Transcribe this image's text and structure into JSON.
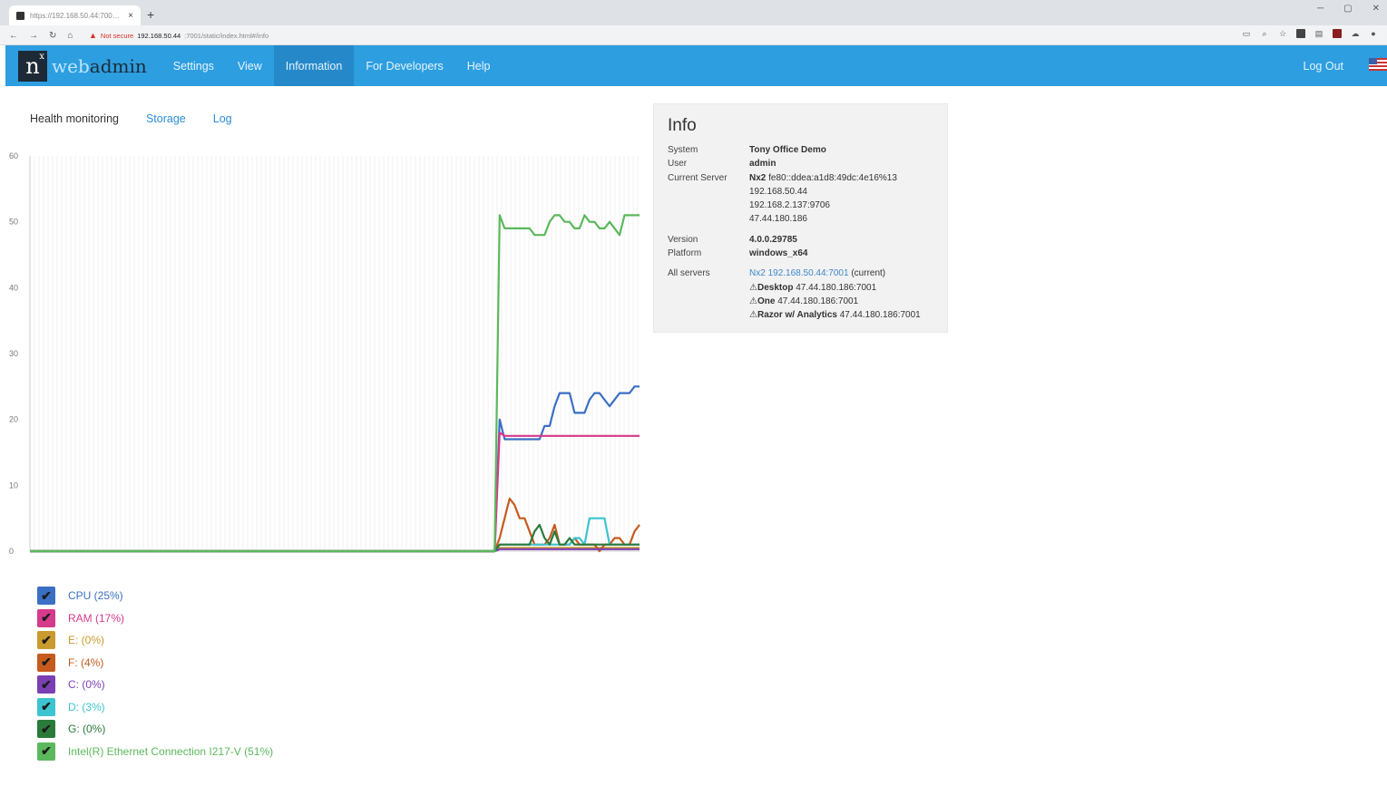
{
  "browser": {
    "tab_title": "https://192.168.50.44:7001/static/index.html#/serv",
    "tab_close": "×",
    "new_tab": "+",
    "not_secure": "Not secure",
    "url_host": "192.168.50.44",
    "url_path": ":7001/static/index.html#/info"
  },
  "app": {
    "logo_mark": "n",
    "logo_sup": "x",
    "logo_web": "web",
    "logo_admin": "admin",
    "menu": [
      "Settings",
      "View",
      "Information",
      "For Developers",
      "Help"
    ],
    "active_menu": "Information",
    "logout": "Log Out"
  },
  "subnav": {
    "health": "Health monitoring",
    "storage": "Storage",
    "log": "Log"
  },
  "chart_data": {
    "type": "line",
    "ylim": [
      0,
      60
    ],
    "y_ticks": [
      "60",
      "50",
      "40",
      "30",
      "20",
      "10",
      "0"
    ],
    "grid": true,
    "series": [
      {
        "name": "CPU (25%)",
        "color": "#3a6fc4",
        "values": [
          0,
          0,
          0,
          0,
          0,
          0,
          0,
          0,
          0,
          0,
          0,
          0,
          0,
          0,
          0,
          0,
          0,
          0,
          0,
          0,
          0,
          0,
          0,
          0,
          0,
          0,
          0,
          0,
          0,
          0,
          0,
          0,
          0,
          0,
          0,
          0,
          0,
          0,
          0,
          0,
          0,
          0,
          0,
          0,
          0,
          0,
          0,
          0,
          0,
          0,
          0,
          0,
          0,
          0,
          0,
          0,
          0,
          0,
          0,
          0,
          0,
          0,
          0,
          0,
          0,
          0,
          0,
          0,
          0,
          0,
          0,
          0,
          0,
          0,
          0,
          0,
          0,
          0,
          0,
          0,
          0,
          0,
          0,
          0,
          0,
          0,
          0,
          0,
          0,
          0,
          0,
          0,
          0,
          0,
          20,
          17,
          17,
          17,
          17,
          17,
          17,
          17,
          17,
          19,
          19,
          22,
          24,
          24,
          24,
          21,
          21,
          21,
          23,
          24,
          24,
          23,
          22,
          23,
          24,
          24,
          24,
          25,
          25
        ]
      },
      {
        "name": "RAM (17%)",
        "color": "#d63a8a",
        "values": [
          0,
          0,
          0,
          0,
          0,
          0,
          0,
          0,
          0,
          0,
          0,
          0,
          0,
          0,
          0,
          0,
          0,
          0,
          0,
          0,
          0,
          0,
          0,
          0,
          0,
          0,
          0,
          0,
          0,
          0,
          0,
          0,
          0,
          0,
          0,
          0,
          0,
          0,
          0,
          0,
          0,
          0,
          0,
          0,
          0,
          0,
          0,
          0,
          0,
          0,
          0,
          0,
          0,
          0,
          0,
          0,
          0,
          0,
          0,
          0,
          0,
          0,
          0,
          0,
          0,
          0,
          0,
          0,
          0,
          0,
          0,
          0,
          0,
          0,
          0,
          0,
          0,
          0,
          0,
          0,
          0,
          0,
          0,
          0,
          0,
          0,
          0,
          0,
          0,
          0,
          0,
          0,
          0,
          0,
          18,
          17.5,
          17.5,
          17.5,
          17.5,
          17.5,
          17.5,
          17.5,
          17.5,
          17.5,
          17.5,
          17.5,
          17.5,
          17.5,
          17.5,
          17.5,
          17.5,
          17.5,
          17.5,
          17.5,
          17.5,
          17.5,
          17.5,
          17.5,
          17.5,
          17.5,
          17.5,
          17.5,
          17.5
        ]
      },
      {
        "name": "E: (0%)",
        "color": "#c99a2e",
        "values": [
          0,
          0,
          0,
          0,
          0,
          0,
          0,
          0,
          0,
          0,
          0,
          0,
          0,
          0,
          0,
          0,
          0,
          0,
          0,
          0,
          0,
          0,
          0,
          0,
          0,
          0,
          0,
          0,
          0,
          0,
          0,
          0,
          0,
          0,
          0,
          0,
          0,
          0,
          0,
          0,
          0,
          0,
          0,
          0,
          0,
          0,
          0,
          0,
          0,
          0,
          0,
          0,
          0,
          0,
          0,
          0,
          0,
          0,
          0,
          0,
          0,
          0,
          0,
          0,
          0,
          0,
          0,
          0,
          0,
          0,
          0,
          0,
          0,
          0,
          0,
          0,
          0,
          0,
          0,
          0,
          0,
          0,
          0,
          0,
          0,
          0,
          0,
          0,
          0,
          0,
          0,
          0,
          0,
          0,
          0.5,
          0.5,
          0.5,
          0.5,
          0.5,
          0.5,
          0.5,
          0.5,
          0.5,
          0.5,
          0.5,
          0.5,
          0.5,
          0.5,
          0.5,
          0.5,
          0.5,
          0.5,
          0.5,
          0.5,
          0.5,
          0.5,
          0.5,
          0.5,
          0.5,
          0.5,
          0.5,
          0.5,
          0.5
        ]
      },
      {
        "name": "F: (4%)",
        "color": "#c55b1e",
        "values": [
          0,
          0,
          0,
          0,
          0,
          0,
          0,
          0,
          0,
          0,
          0,
          0,
          0,
          0,
          0,
          0,
          0,
          0,
          0,
          0,
          0,
          0,
          0,
          0,
          0,
          0,
          0,
          0,
          0,
          0,
          0,
          0,
          0,
          0,
          0,
          0,
          0,
          0,
          0,
          0,
          0,
          0,
          0,
          0,
          0,
          0,
          0,
          0,
          0,
          0,
          0,
          0,
          0,
          0,
          0,
          0,
          0,
          0,
          0,
          0,
          0,
          0,
          0,
          0,
          0,
          0,
          0,
          0,
          0,
          0,
          0,
          0,
          0,
          0,
          0,
          0,
          0,
          0,
          0,
          0,
          0,
          0,
          0,
          0,
          0,
          0,
          0,
          0,
          0,
          0,
          0,
          0,
          0,
          0,
          2,
          5,
          8,
          7,
          5,
          5,
          3,
          1,
          1,
          1,
          2,
          4,
          1,
          1,
          1,
          2,
          1,
          1,
          1,
          1,
          0,
          1,
          1,
          2,
          2,
          1,
          1,
          3,
          4
        ]
      },
      {
        "name": "C: (0%)",
        "color": "#7b3fb4",
        "values": [
          0,
          0,
          0,
          0,
          0,
          0,
          0,
          0,
          0,
          0,
          0,
          0,
          0,
          0,
          0,
          0,
          0,
          0,
          0,
          0,
          0,
          0,
          0,
          0,
          0,
          0,
          0,
          0,
          0,
          0,
          0,
          0,
          0,
          0,
          0,
          0,
          0,
          0,
          0,
          0,
          0,
          0,
          0,
          0,
          0,
          0,
          0,
          0,
          0,
          0,
          0,
          0,
          0,
          0,
          0,
          0,
          0,
          0,
          0,
          0,
          0,
          0,
          0,
          0,
          0,
          0,
          0,
          0,
          0,
          0,
          0,
          0,
          0,
          0,
          0,
          0,
          0,
          0,
          0,
          0,
          0,
          0,
          0,
          0,
          0,
          0,
          0,
          0,
          0,
          0,
          0,
          0,
          0,
          0,
          0.3,
          0.3,
          0.3,
          0.3,
          0.3,
          0.3,
          0.3,
          0.3,
          0.3,
          0.3,
          0.3,
          0.3,
          0.3,
          0.3,
          0.3,
          0.3,
          0.3,
          0.3,
          0.3,
          0.3,
          0.3,
          0.3,
          0.3,
          0.3,
          0.3,
          0.3,
          0.3,
          0.3,
          0.3
        ]
      },
      {
        "name": "D: (3%)",
        "color": "#3cc4d0",
        "values": [
          0,
          0,
          0,
          0,
          0,
          0,
          0,
          0,
          0,
          0,
          0,
          0,
          0,
          0,
          0,
          0,
          0,
          0,
          0,
          0,
          0,
          0,
          0,
          0,
          0,
          0,
          0,
          0,
          0,
          0,
          0,
          0,
          0,
          0,
          0,
          0,
          0,
          0,
          0,
          0,
          0,
          0,
          0,
          0,
          0,
          0,
          0,
          0,
          0,
          0,
          0,
          0,
          0,
          0,
          0,
          0,
          0,
          0,
          0,
          0,
          0,
          0,
          0,
          0,
          0,
          0,
          0,
          0,
          0,
          0,
          0,
          0,
          0,
          0,
          0,
          0,
          0,
          0,
          0,
          0,
          0,
          0,
          0,
          0,
          0,
          0,
          0,
          0,
          0,
          0,
          0,
          0,
          0,
          0,
          1,
          1,
          1,
          1,
          1,
          1,
          1,
          1,
          1,
          1,
          1,
          1,
          1,
          1,
          1,
          2,
          2,
          1,
          5,
          5,
          5,
          5,
          1,
          1,
          1,
          1,
          1,
          1,
          1
        ]
      },
      {
        "name": "G: (0%)",
        "color": "#2a7a3a",
        "values": [
          0,
          0,
          0,
          0,
          0,
          0,
          0,
          0,
          0,
          0,
          0,
          0,
          0,
          0,
          0,
          0,
          0,
          0,
          0,
          0,
          0,
          0,
          0,
          0,
          0,
          0,
          0,
          0,
          0,
          0,
          0,
          0,
          0,
          0,
          0,
          0,
          0,
          0,
          0,
          0,
          0,
          0,
          0,
          0,
          0,
          0,
          0,
          0,
          0,
          0,
          0,
          0,
          0,
          0,
          0,
          0,
          0,
          0,
          0,
          0,
          0,
          0,
          0,
          0,
          0,
          0,
          0,
          0,
          0,
          0,
          0,
          0,
          0,
          0,
          0,
          0,
          0,
          0,
          0,
          0,
          0,
          0,
          0,
          0,
          0,
          0,
          0,
          0,
          0,
          0,
          0,
          0,
          0,
          0,
          1,
          1,
          1,
          1,
          1,
          1,
          1,
          3,
          4,
          2,
          1,
          3,
          1,
          1,
          2,
          1,
          1,
          1,
          1,
          1,
          1,
          1,
          1,
          1,
          1,
          1,
          1,
          1,
          1
        ]
      },
      {
        "name": "Intel(R) Ethernet Connection I217-V (51%)",
        "color": "#5cb85c",
        "values": [
          0,
          0,
          0,
          0,
          0,
          0,
          0,
          0,
          0,
          0,
          0,
          0,
          0,
          0,
          0,
          0,
          0,
          0,
          0,
          0,
          0,
          0,
          0,
          0,
          0,
          0,
          0,
          0,
          0,
          0,
          0,
          0,
          0,
          0,
          0,
          0,
          0,
          0,
          0,
          0,
          0,
          0,
          0,
          0,
          0,
          0,
          0,
          0,
          0,
          0,
          0,
          0,
          0,
          0,
          0,
          0,
          0,
          0,
          0,
          0,
          0,
          0,
          0,
          0,
          0,
          0,
          0,
          0,
          0,
          0,
          0,
          0,
          0,
          0,
          0,
          0,
          0,
          0,
          0,
          0,
          0,
          0,
          0,
          0,
          0,
          0,
          0,
          0,
          0,
          0,
          0,
          0,
          0,
          0,
          51,
          49,
          49,
          49,
          49,
          49,
          49,
          48,
          48,
          48,
          50,
          51,
          51,
          50,
          50,
          49,
          49,
          51,
          50,
          50,
          49,
          49,
          50,
          49,
          48,
          51,
          51,
          51,
          51
        ]
      }
    ]
  },
  "legend_check": "✔",
  "info": {
    "title": "Info",
    "rows": {
      "system_label": "System",
      "system": "Tony Office Demo",
      "user_label": "User",
      "user": "admin",
      "server_label": "Current Server",
      "server_name": "Nx2",
      "server_ipv6": "fe80::ddea:a1d8:49dc:4e16%13",
      "ip1": "192.168.50.44",
      "ip2": "192.168.2.137:9706",
      "ip3": "47.44.180.186",
      "version_label": "Version",
      "version": "4.0.0.29785",
      "platform_label": "Platform",
      "platform": "windows_x64",
      "all_label": "All servers",
      "s1_name": "Nx2",
      "s1_link": "192.168.50.44:7001",
      "s1_note": "(current)",
      "warn": "⚠",
      "s2_name": "Desktop",
      "s2_addr": "47.44.180.186:7001",
      "s3_name": "One",
      "s3_addr": "47.44.180.186:7001",
      "s4_name": "Razor w/ Analytics",
      "s4_addr": "47.44.180.186:7001"
    }
  }
}
